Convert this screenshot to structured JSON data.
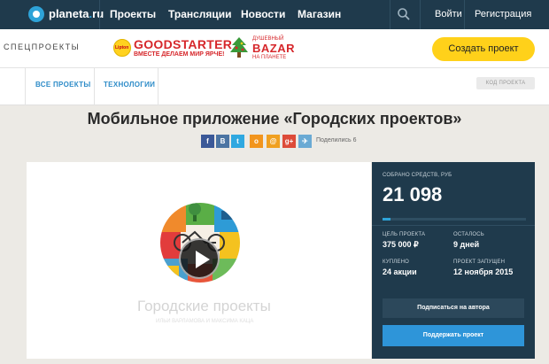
{
  "header": {
    "brand": "planeta",
    "brand_dot": ".",
    "brand_suffix": "ru",
    "nav": [
      "Проекты",
      "Трансляции",
      "Новости",
      "Магазин"
    ],
    "login": "Войти",
    "register": "Регистрация"
  },
  "specbar": {
    "label": "СПЕЦПРОЕКТЫ",
    "lipton_logo_text": "Lipton",
    "goodstarter_title": "GOODSTARTER",
    "goodstarter_sub": "ВМЕСТЕ ДЕЛАЕМ МИР ЯРЧЕ!",
    "bazar_top": "ДУШЕВНЫЙ",
    "bazar_main": "BAZAR",
    "bazar_bottom": "НА ПЛАНЕТЕ",
    "create_button": "Создать проект"
  },
  "categories": {
    "items": [
      "ВСЕ ПРОЕКТЫ",
      "ТЕХНОЛОГИИ"
    ],
    "code_button": "КОД ПРОЕКТА"
  },
  "project": {
    "title": "Мобильное приложение «Городских проектов»",
    "share_label": "Поделились 6",
    "share_icons": [
      "facebook-icon",
      "vk-icon",
      "twitter-icon",
      "odnoklassniki-icon",
      "mail-icon",
      "google-plus-icon",
      "livejournal-icon"
    ],
    "share_glyphs": [
      "f",
      "B",
      "t",
      "o",
      "@",
      "g+",
      "✈"
    ]
  },
  "video": {
    "title": "Городские проекты",
    "subtitle": "ИЛЬИ ВАРЛАМОВА И МАКСИМА КАЦА"
  },
  "stats": {
    "collected_label": "СОБРАНО СРЕДСТВ, РУБ",
    "collected_value": "21 098",
    "progress_fraction": 0.056,
    "goal_label": "ЦЕЛЬ ПРОЕКТА",
    "goal_value": "375 000 ₽",
    "left_label": "ОСТАЛОСЬ",
    "left_value": "9 дней",
    "bought_label": "КУПЛЕНО",
    "bought_value": "24 акции",
    "started_label": "ПРОЕКТ ЗАПУЩЕН",
    "started_value": "12 ноября 2015",
    "subscribe_button": "Подписаться на автора",
    "support_button": "Поддержать проект"
  },
  "colors": {
    "nav_bg": "#1f3a4c",
    "accent_blue": "#2ea3d8",
    "create_yellow": "#ffd11a",
    "brand_red": "#d6272b"
  }
}
